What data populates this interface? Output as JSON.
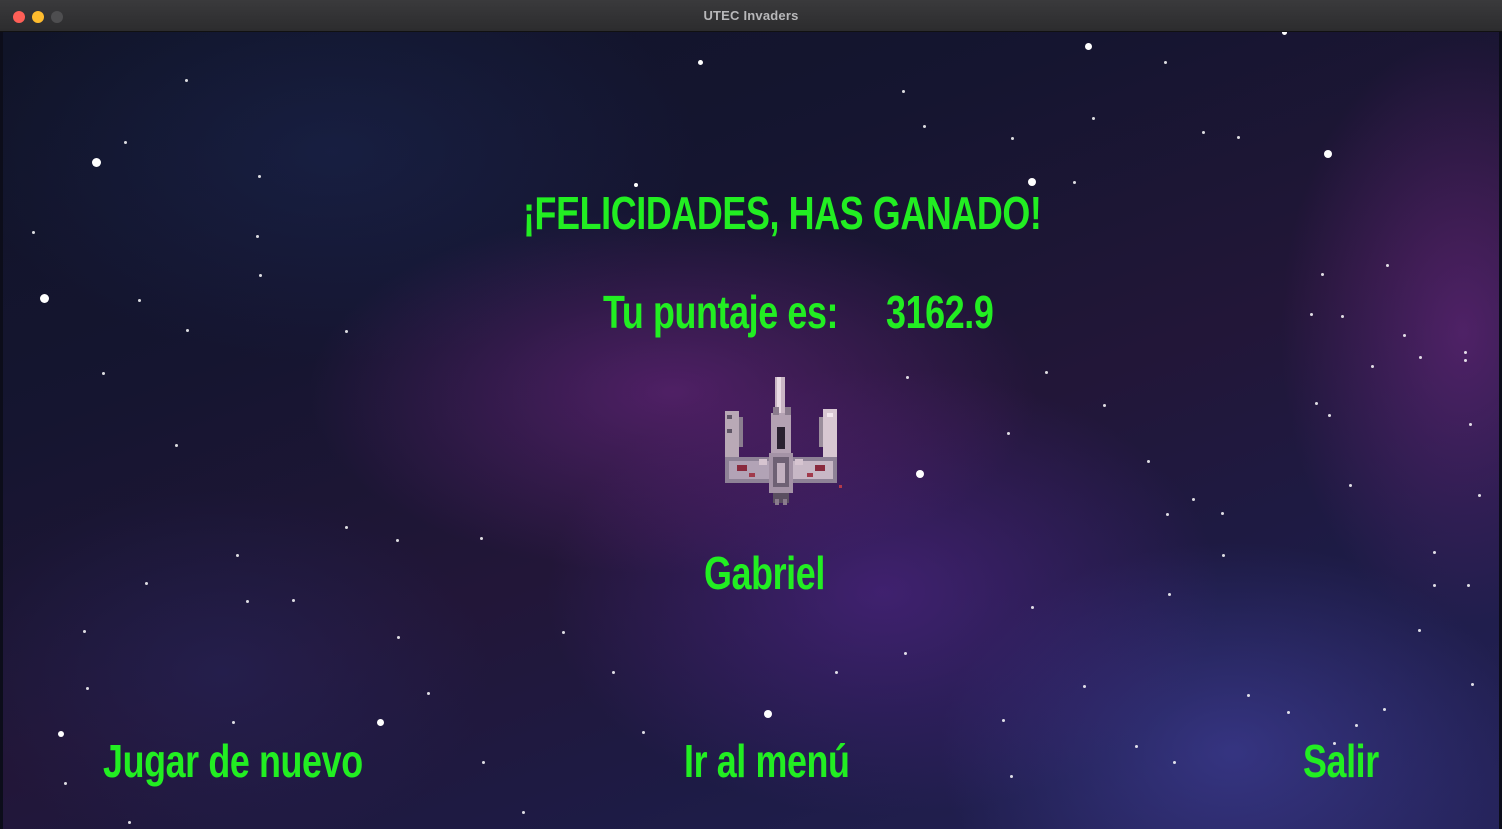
{
  "window": {
    "title": "UTEC Invaders"
  },
  "game_over": {
    "headline": "¡FELICIDADES, HAS GANADO!",
    "score_label": "Tu puntaje es:",
    "score_value": "3162.9",
    "player_name": "Gabriel",
    "ship_sprite": "x-wing-spaceship"
  },
  "buttons": {
    "play_again": "Jugar de nuevo",
    "menu": "Ir al menú",
    "exit": "Salir"
  },
  "colors": {
    "text": "#22ee22",
    "close_button": "#fe5f57",
    "minimize_button": "#febc2e"
  }
}
